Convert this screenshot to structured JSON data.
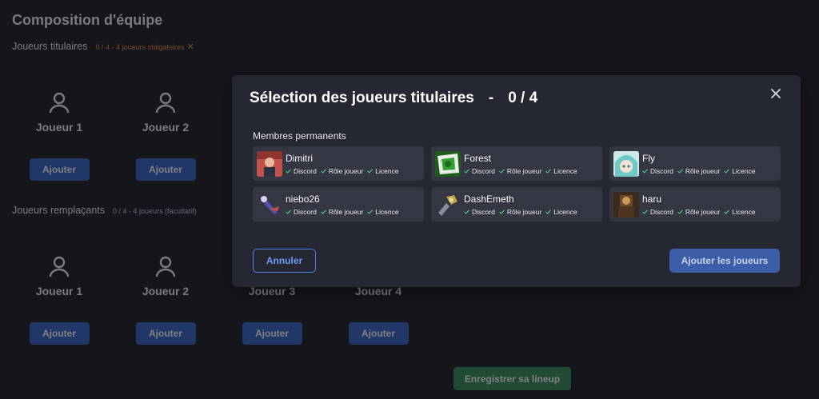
{
  "page": {
    "title": "Composition d'équipe",
    "titulaires": {
      "label": "Joueurs titulaires",
      "hint": "0 / 4 - 4 joueurs obligatoires",
      "hint_icon": "x-icon",
      "players": [
        "Joueur 1",
        "Joueur 2"
      ],
      "add_label": "Ajouter"
    },
    "remplacants": {
      "label": "Joueurs remplaçants",
      "hint": "0 / 4 - 4 joueurs (facultatif)",
      "players": [
        "Joueur 1",
        "Joueur 2",
        "Joueur 3",
        "Joueur 4"
      ],
      "add_label": "Ajouter"
    },
    "save_label": "Enregistrer sa lineup"
  },
  "modal": {
    "title": "Sélection des joueurs titulaires",
    "separator": "-",
    "count": "0 / 4",
    "members_label": "Membres permanents",
    "check_labels": [
      "Discord",
      "Rôle joueur",
      "Licence"
    ],
    "members": [
      {
        "name": "Dimitri",
        "avatar": "avatar-dimitri",
        "avatar_color": "#c0524a"
      },
      {
        "name": "Forest",
        "avatar": "avatar-forest",
        "avatar_color": "#2f7d2a"
      },
      {
        "name": "Fly",
        "avatar": "avatar-fly",
        "avatar_color": "#6fc9c4"
      },
      {
        "name": "niebo26",
        "avatar": "avatar-niebo26",
        "avatar_color": "#5b4fa6"
      },
      {
        "name": "DashEmeth",
        "avatar": "avatar-dashemeth",
        "avatar_color": "#b9a34c"
      },
      {
        "name": "haru",
        "avatar": "avatar-haru",
        "avatar_color": "#6a4a2a"
      }
    ],
    "cancel_label": "Annuler",
    "confirm_label": "Ajouter les joueurs"
  },
  "colors": {
    "background": "#15161c",
    "modal": "#252733",
    "card": "#343643",
    "primary": "#2f5fc4",
    "success": "#2e8a52",
    "warning": "#f08a3c",
    "check": "#4fc08d"
  }
}
